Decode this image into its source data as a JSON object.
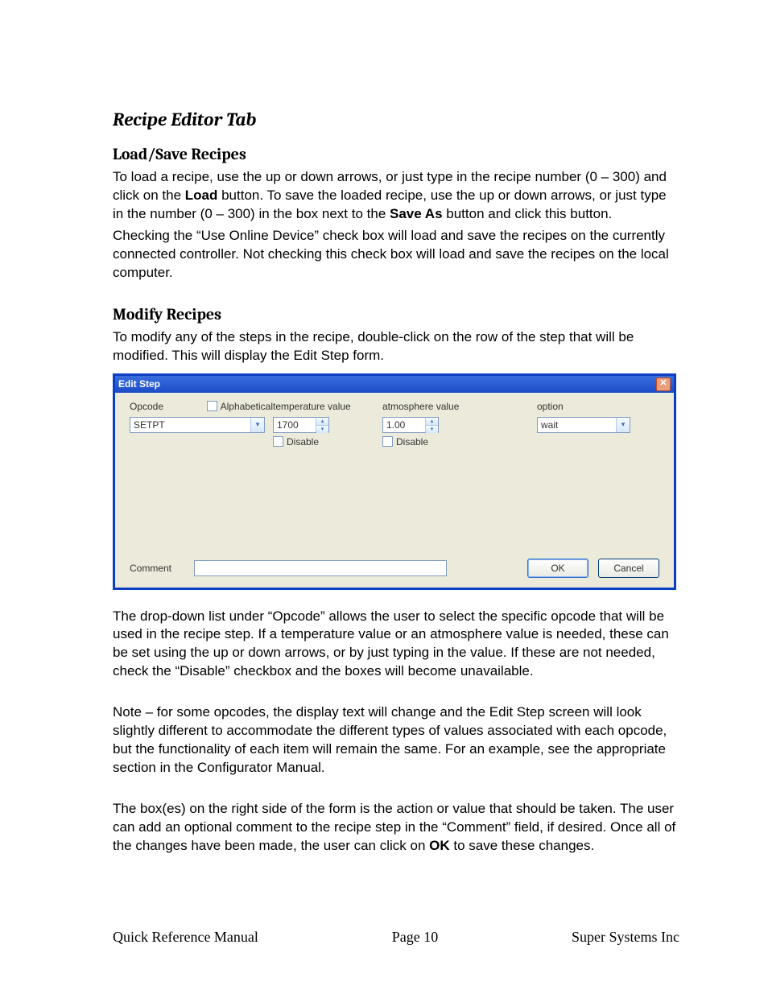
{
  "section_title": "Recipe Editor Tab",
  "sub1_title": "Load/Save Recipes",
  "para1_a": "To load a recipe, use the up or down arrows, or just type in the recipe number (0 – 300) and click on the ",
  "para1_b_bold": "Load",
  "para1_c": " button.  To save the loaded recipe, use the up or down arrows, or just type in the number (0 – 300) in the box next to the ",
  "para1_d_bold": "Save As",
  "para1_e": " button and click this button.",
  "para1_f": "Checking the “Use Online Device” check box will load and save the recipes on the currently connected controller. Not checking this check box will load and save the recipes on the local computer.",
  "sub2_title": "Modify Recipes",
  "para2": "To modify any of the steps in the recipe, double-click on the row of the step that will be modified. This will display the Edit Step form.",
  "dialog": {
    "title": "Edit Step",
    "opcode_label": "Opcode",
    "alpha_label": "Alphabetical",
    "opcode_value": "SETPT",
    "temp_label": "temperature value",
    "temp_value": "1700",
    "temp_disable": "Disable",
    "atmo_label": "atmosphere value",
    "atmo_value": "1.00",
    "atmo_disable": "Disable",
    "option_label": "option",
    "option_value": "wait",
    "comment_label": "Comment",
    "ok": "OK",
    "cancel": "Cancel"
  },
  "para3": "The drop-down list under “Opcode” allows the user to select the specific opcode that will be used in the recipe step. If a temperature value or an atmosphere value is needed, these can be set using the up or down arrows, or by just typing in the value. If these are not needed, check the “Disable” checkbox and the boxes will become unavailable.",
  "para4": "Note – for some opcodes, the display text will change and the Edit Step screen will look slightly different to accommodate the different types of values associated with each opcode, but the functionality of each item will remain the same. For an example, see the appropriate section in the Configurator Manual.",
  "para5_a": "The box(es) on the right side of the form is the action or value that should be taken. The user can add an optional comment to the recipe step in the “Comment” field, if desired. Once all of the changes have been made, the user can click on ",
  "para5_b_bold": "OK",
  "para5_c": " to save these changes.",
  "footer_left": "Quick Reference Manual",
  "footer_mid": "Page 10",
  "footer_right": "Super Systems Inc"
}
